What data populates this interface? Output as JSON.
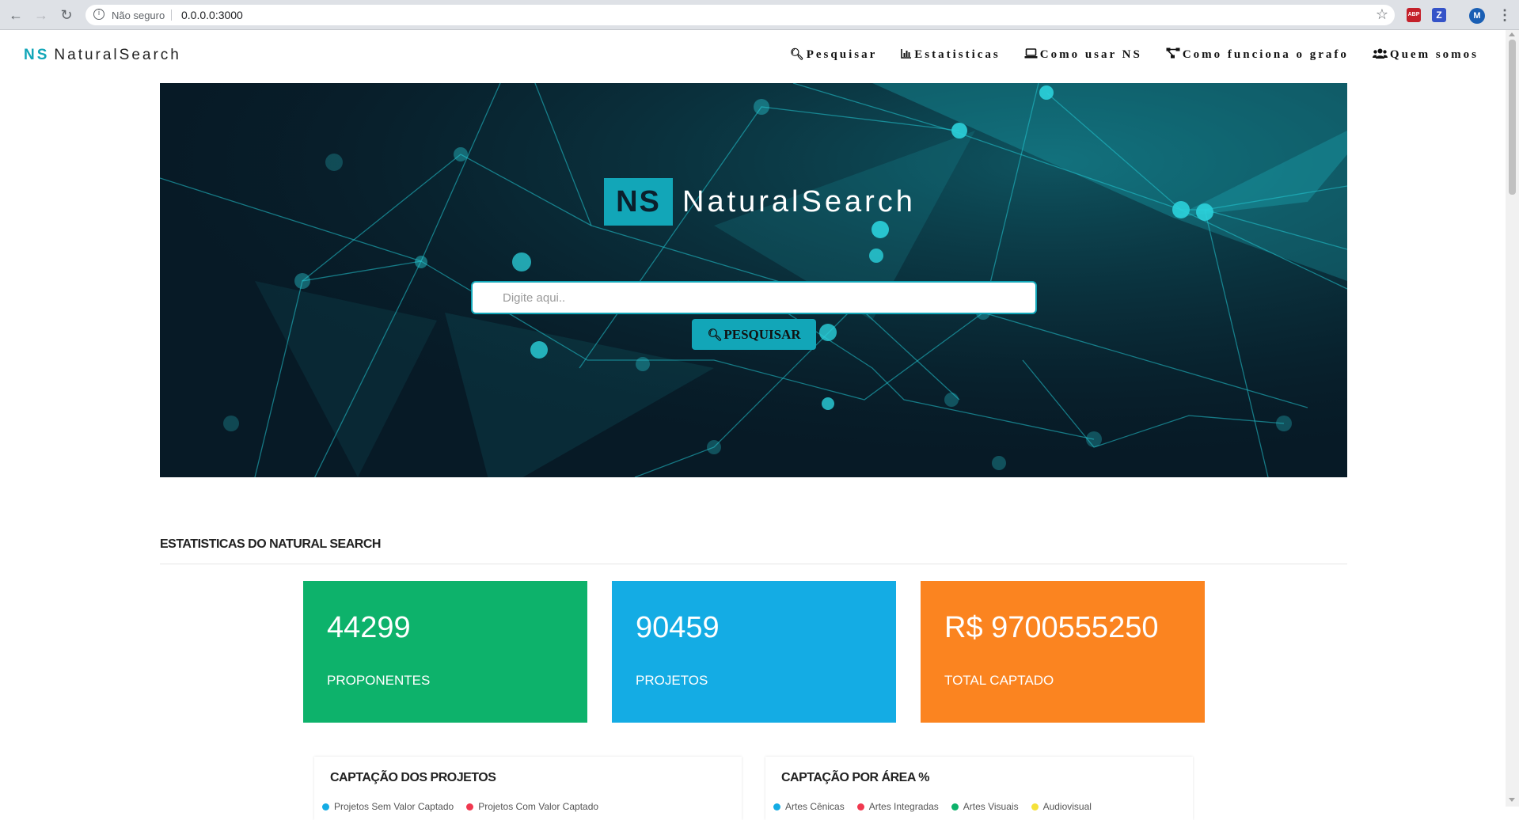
{
  "browser": {
    "secure_label": "Não seguro",
    "url": "0.0.0.0:3000",
    "ext_abp": "ABP",
    "ext_z": "Z",
    "profile": "M"
  },
  "navbar": {
    "brand_ns": "NS",
    "brand_name": "NaturalSearch",
    "links": [
      {
        "icon": "search-icon",
        "label": "Pesquisar"
      },
      {
        "icon": "chart-icon",
        "label": "Estatisticas"
      },
      {
        "icon": "laptop-icon",
        "label": "Como usar NS"
      },
      {
        "icon": "graph-icon",
        "label": "Como funciona o grafo"
      },
      {
        "icon": "users-icon",
        "label": "Quem somos"
      }
    ]
  },
  "hero": {
    "badge": "NS",
    "title": "NaturalSearch",
    "search_placeholder": "Digite aqui..",
    "search_button": "PESQUISAR"
  },
  "stats": {
    "section_title": "ESTATISTICAS DO NATURAL SEARCH",
    "cards": [
      {
        "value": "44299",
        "label": "PROPONENTES",
        "color": "#0db26b"
      },
      {
        "value": "90459",
        "label": "PROJETOS",
        "color": "#14ace4"
      },
      {
        "value": "R$ 9700555250",
        "label": "TOTAL CAPTADO",
        "color": "#fb8420"
      }
    ]
  },
  "charts": [
    {
      "title": "CAPTAÇÃO DOS PROJETOS",
      "legend": [
        {
          "label": "Projetos Sem Valor Captado",
          "color": "#14ace4"
        },
        {
          "label": "Projetos Com Valor Captado",
          "color": "#f0384f"
        }
      ]
    },
    {
      "title": "CAPTAÇÃO POR ÁREA %",
      "legend": [
        {
          "label": "Artes Cênicas",
          "color": "#14ace4"
        },
        {
          "label": "Artes Integradas",
          "color": "#f0384f"
        },
        {
          "label": "Artes Visuais",
          "color": "#0db26b"
        },
        {
          "label": "Audiovisual",
          "color": "#f5e23a"
        }
      ]
    }
  ]
}
